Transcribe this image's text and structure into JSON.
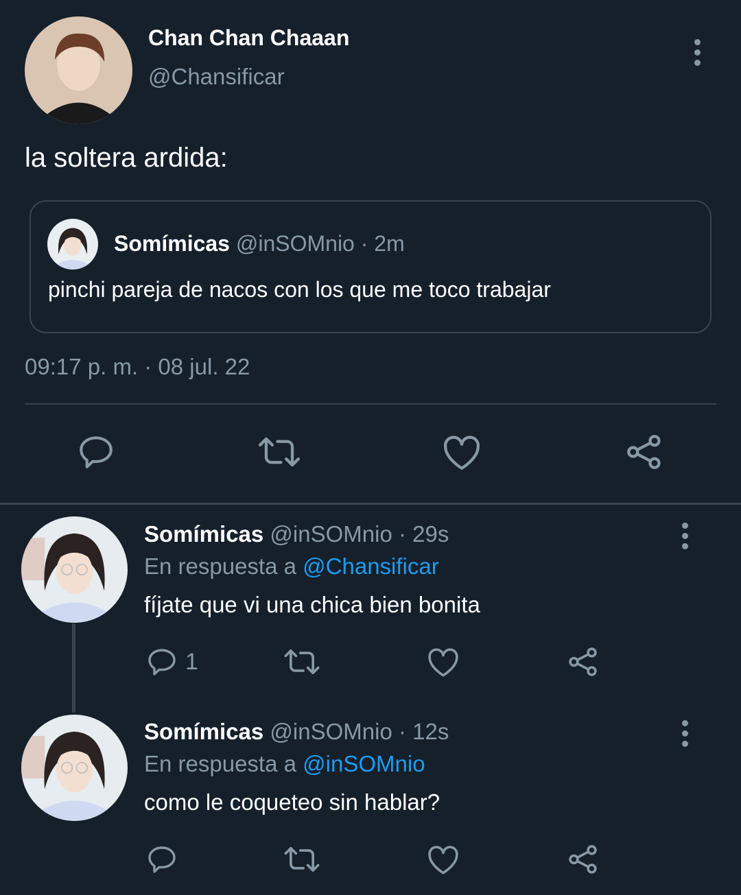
{
  "main_tweet": {
    "author_name": "Chan Chan Chaaan",
    "author_handle": "@Chansificar",
    "text": "la soltera ardida:",
    "timestamp": "09:17 p. m. · 08 jul. 22",
    "actions": [
      "reply-icon",
      "retweet-icon",
      "like-icon",
      "share-icon"
    ]
  },
  "quoted_tweet": {
    "author_name": "Somímicas",
    "author_handle": "@inSOMnio",
    "time": "· 2m",
    "text": "pinchi pareja de nacos con los que me toco trabajar"
  },
  "replies": [
    {
      "author_name": "Somímicas",
      "author_handle": "@inSOMnio",
      "time": "· 29s",
      "reply_prefix": "En respuesta a",
      "reply_to": "@Chansificar",
      "text": "fíjate que vi una chica bien bonita",
      "reply_count": "1"
    },
    {
      "author_name": "Somímicas",
      "author_handle": "@inSOMnio",
      "time": "· 12s",
      "reply_prefix": "En respuesta a",
      "reply_to": "@inSOMnio",
      "text": "como le coqueteo sin hablar?",
      "reply_count": ""
    }
  ],
  "colors": {
    "background": "#15202b",
    "secondary_text": "#8899a6",
    "link": "#1d9bf0",
    "divider": "#38444d"
  }
}
